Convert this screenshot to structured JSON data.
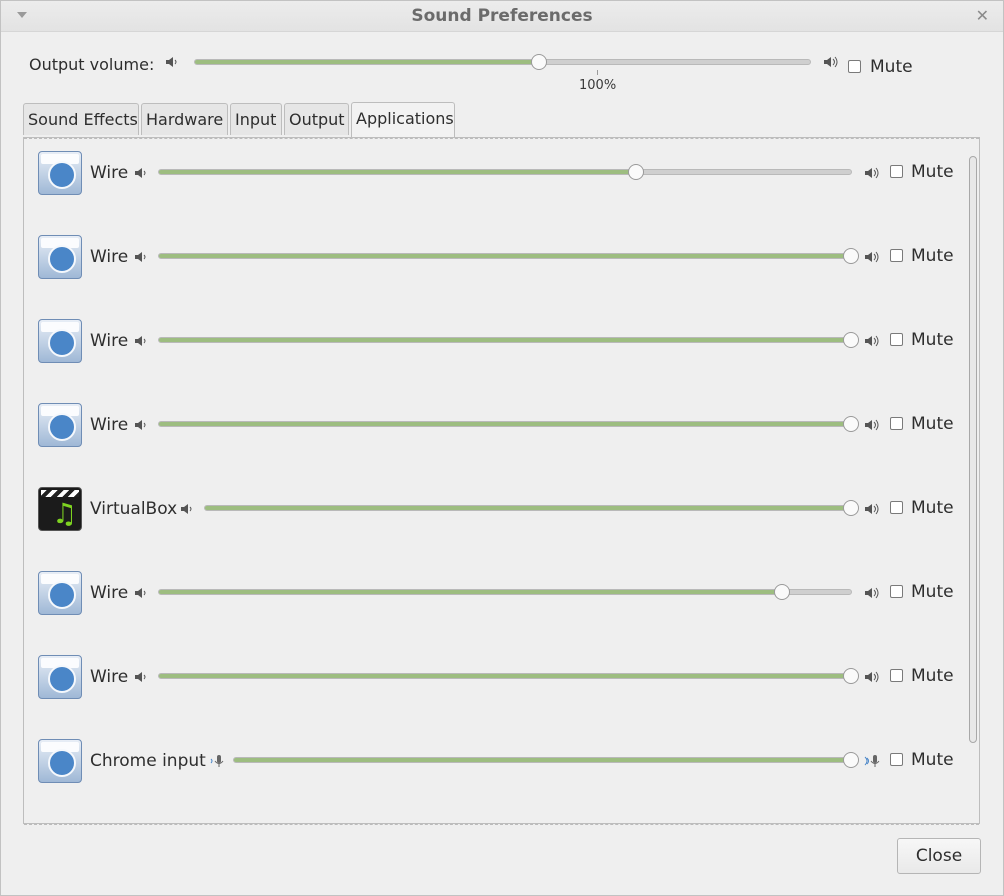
{
  "window": {
    "title": "Sound Preferences"
  },
  "output": {
    "label": "Output volume:",
    "percent_label": "100%",
    "level": 0.56,
    "mute_label": "Mute",
    "muted": false
  },
  "tabs": [
    {
      "label": "Sound Effects",
      "active": false
    },
    {
      "label": "Hardware",
      "active": false
    },
    {
      "label": "Input",
      "active": false
    },
    {
      "label": "Output",
      "active": false
    },
    {
      "label": "Applications",
      "active": true
    }
  ],
  "apps": [
    {
      "name": "Wire",
      "icon": "chrome-app-icon",
      "level": 0.69,
      "mute_label": "Mute",
      "muted": false
    },
    {
      "name": "Wire",
      "icon": "chrome-app-icon",
      "level": 1.0,
      "mute_label": "Mute",
      "muted": false
    },
    {
      "name": "Wire",
      "icon": "chrome-app-icon",
      "level": 1.0,
      "mute_label": "Mute",
      "muted": false
    },
    {
      "name": "Wire",
      "icon": "chrome-app-icon",
      "level": 1.0,
      "mute_label": "Mute",
      "muted": false
    },
    {
      "name": "VirtualBox",
      "icon": "media-player-icon",
      "level": 1.0,
      "mute_label": "Mute",
      "muted": false
    },
    {
      "name": "Wire",
      "icon": "chrome-app-icon",
      "level": 0.9,
      "mute_label": "Mute",
      "muted": false
    },
    {
      "name": "Wire",
      "icon": "chrome-app-icon",
      "level": 1.0,
      "mute_label": "Mute",
      "muted": false
    },
    {
      "name": "Chrome input",
      "icon": "chrome-app-icon",
      "level": 1.0,
      "mute_label": "Mute",
      "muted": false,
      "input": true
    }
  ],
  "buttons": {
    "close_label": "Close"
  },
  "colors": {
    "slider_fill": "#9dbd80",
    "window_bg": "#efefef"
  }
}
